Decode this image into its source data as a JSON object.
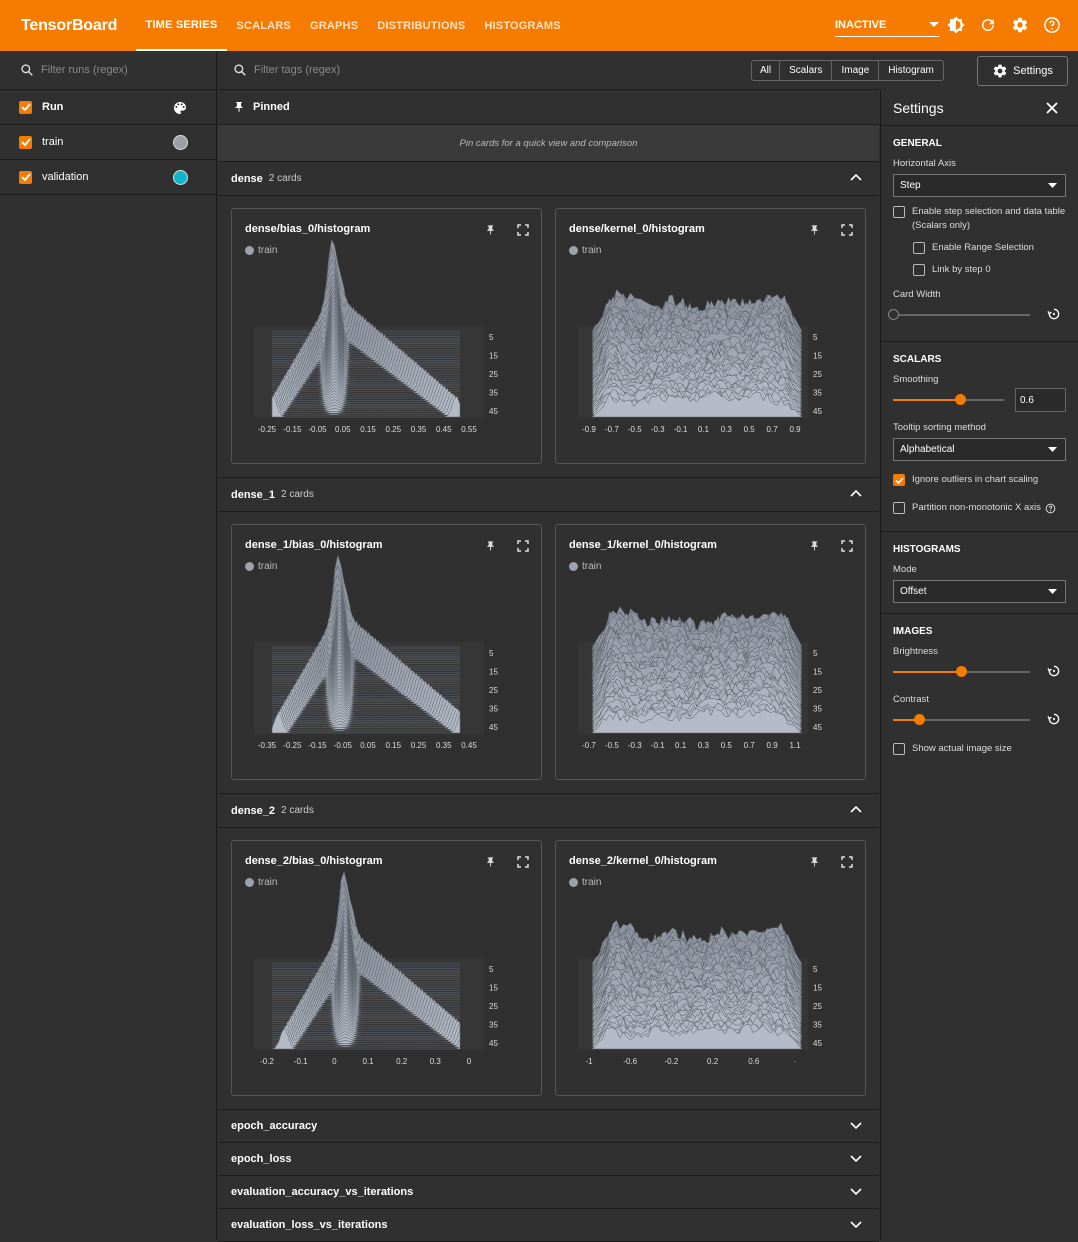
{
  "app": {
    "title": "TensorBoard"
  },
  "nav": {
    "tabs": [
      "TIME SERIES",
      "SCALARS",
      "GRAPHS",
      "DISTRIBUTIONS",
      "HISTOGRAMS"
    ],
    "status": "INACTIVE"
  },
  "sidebar": {
    "filter_placeholder": "Filter runs (regex)",
    "header_label": "Run",
    "runs": [
      {
        "label": "train",
        "color": "#9aa0a6"
      },
      {
        "label": "validation",
        "color": "#12b5cb"
      }
    ]
  },
  "toolbar": {
    "filter_tags_placeholder": "Filter tags (regex)",
    "type_filters": [
      "All",
      "Scalars",
      "Image",
      "Histogram"
    ],
    "settings_label": "Settings"
  },
  "pinned": {
    "title": "Pinned",
    "note": "Pin cards for a quick view and comparison"
  },
  "groups": [
    {
      "name": "dense",
      "count": "2 cards",
      "cards": [
        {
          "title": "dense/bias_0/histogram",
          "run": "train",
          "xticks": [
            "-0.25",
            "-0.15",
            "-0.05",
            "0.05",
            "0.15",
            "0.25",
            "0.35",
            "0.45",
            "0.55"
          ]
        },
        {
          "title": "dense/kernel_0/histogram",
          "run": "train",
          "xticks": [
            "-0.9",
            "-0.7",
            "-0.5",
            "-0.3",
            "-0.1",
            "0.1",
            "0.3",
            "0.5",
            "0.7",
            "0.9"
          ]
        }
      ]
    },
    {
      "name": "dense_1",
      "count": "2 cards",
      "cards": [
        {
          "title": "dense_1/bias_0/histogram",
          "run": "train",
          "xticks": [
            "-0.35",
            "-0.25",
            "-0.15",
            "-0.05",
            "0.05",
            "0.15",
            "0.25",
            "0.35",
            "0.45"
          ]
        },
        {
          "title": "dense_1/kernel_0/histogram",
          "run": "train",
          "xticks": [
            "-0.7",
            "-0.5",
            "-0.3",
            "-0.1",
            "0.1",
            "0.3",
            "0.5",
            "0.7",
            "0.9",
            "1.1"
          ]
        }
      ]
    },
    {
      "name": "dense_2",
      "count": "2 cards",
      "cards": [
        {
          "title": "dense_2/bias_0/histogram",
          "run": "train",
          "xticks": [
            "-0.2",
            "-0.1",
            "0",
            "0.1",
            "0.2",
            "0.3",
            "0"
          ]
        },
        {
          "title": "dense_2/kernel_0/histogram",
          "run": "train",
          "xticks": [
            "-1",
            "-0.6",
            "-0.2",
            "0.2",
            "0.6",
            "·"
          ]
        }
      ]
    }
  ],
  "y_ticks": [
    "5",
    "15",
    "25",
    "35",
    "45"
  ],
  "collapsed_groups": [
    "epoch_accuracy",
    "epoch_loss",
    "evaluation_accuracy_vs_iterations",
    "evaluation_loss_vs_iterations"
  ],
  "settings": {
    "title": "Settings",
    "general": {
      "title": "GENERAL",
      "horizontal_axis_label": "Horizontal Axis",
      "horizontal_axis_value": "Step",
      "step_selection_label": "Enable step selection and data table (Scalars only)",
      "range_selection_label": "Enable Range Selection",
      "link_by_step_label": "Link by step 0",
      "card_width_label": "Card Width",
      "card_width_level": 0
    },
    "scalars": {
      "title": "SCALARS",
      "smoothing_label": "Smoothing",
      "smoothing_value": "0.6",
      "tooltip_label": "Tooltip sorting method",
      "tooltip_value": "Alphabetical",
      "ignore_outliers_label": "Ignore outliers in chart scaling",
      "partition_label": "Partition non-monotonic X axis"
    },
    "histograms": {
      "title": "HISTOGRAMS",
      "mode_label": "Mode",
      "mode_value": "Offset"
    },
    "images": {
      "title": "IMAGES",
      "brightness_label": "Brightness",
      "brightness_level": 0.5,
      "contrast_label": "Contrast",
      "contrast_level": 0.2,
      "actual_size_label": "Show actual image size"
    }
  },
  "colors": {
    "accent": "#f57c00",
    "background": "#303030",
    "histogram": "#9aa3ae"
  }
}
